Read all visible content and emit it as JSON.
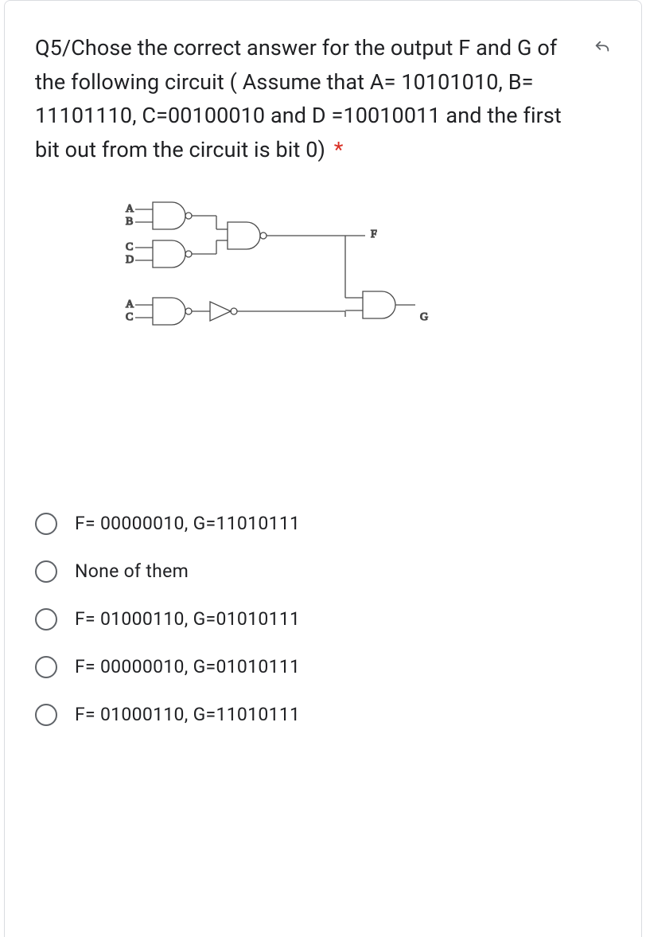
{
  "question": {
    "text": "Q5/Chose the correct answer for the output F and G of the following circuit  ( Assume that A= 10101010, B= 11101110, C=00100010 and D =10010011 and the first bit out from the circuit is bit 0)",
    "required_marker": "*",
    "undo_tooltip": "Clear selection"
  },
  "diagram": {
    "inputs": [
      "A",
      "B",
      "C",
      "D",
      "A",
      "C"
    ],
    "outputs": [
      "F",
      "G"
    ],
    "gates": [
      "NAND",
      "NAND",
      "NAND",
      "NAND",
      "NOT",
      "AND"
    ]
  },
  "options": [
    {
      "label": "F= 00000010, G=11010111"
    },
    {
      "label": "None of them"
    },
    {
      "label": "F= 01000110, G=01010111"
    },
    {
      "label": "F= 00000010, G=01010111"
    },
    {
      "label": "F= 01000110, G=11010111"
    }
  ]
}
